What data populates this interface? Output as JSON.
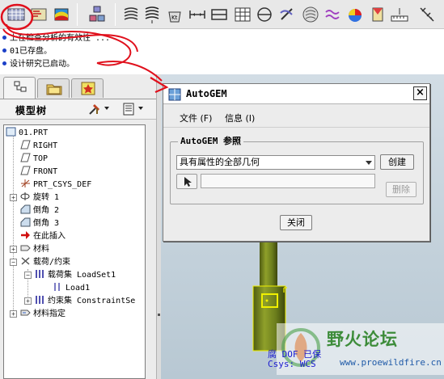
{
  "messages": [
    "上在检查分析的有效性 ...",
    "01已存盘。",
    "设计研究已启动。"
  ],
  "nav": {
    "tree_title": "模型树"
  },
  "tree": [
    {
      "label": "01.PRT",
      "icon": "part-icon"
    },
    {
      "label": "RIGHT",
      "icon": "datum-plane-icon"
    },
    {
      "label": "TOP",
      "icon": "datum-plane-icon"
    },
    {
      "label": "FRONT",
      "icon": "datum-plane-icon"
    },
    {
      "label": "PRT_CSYS_DEF",
      "icon": "csys-icon"
    },
    {
      "label": "旋转 1",
      "icon": "revolve-icon"
    },
    {
      "label": "倒角 2",
      "icon": "chamfer-icon"
    },
    {
      "label": "倒角 3",
      "icon": "chamfer-icon"
    },
    {
      "label": "在此插入",
      "icon": "insert-here-arrow-icon"
    },
    {
      "label": "材料",
      "icon": "material-icon"
    },
    {
      "label": "载荷/约束",
      "icon": "load-constraint-icon"
    },
    {
      "label": "载荷集 LoadSet1",
      "icon": "load-set-icon"
    },
    {
      "label": "Load1",
      "icon": "load-icon"
    },
    {
      "label": "约束集 ConstraintSe",
      "icon": "constraint-set-icon"
    },
    {
      "label": "材料指定",
      "icon": "material-assign-icon"
    }
  ],
  "dialog": {
    "title": "AutoGEM",
    "close_label": "×",
    "menu_file": "文件 (F)",
    "menu_info": "信息 (I)",
    "group_label": "AutoGEM 参照",
    "select_value": "具有属性的全部几何",
    "create_label": "创建",
    "delete_label": "删除",
    "close_button_label": "关闭"
  },
  "graphics": {
    "overlay_text": "腐 DOF 已保\nCsys: WCS"
  },
  "watermark": {
    "title": "野火论坛",
    "url": "www.proewildfire.cn"
  },
  "colors": {
    "annotation_red": "#e0101c",
    "shaft_green": "#6b7d1c",
    "highlight_yellow": "#f0f000"
  }
}
